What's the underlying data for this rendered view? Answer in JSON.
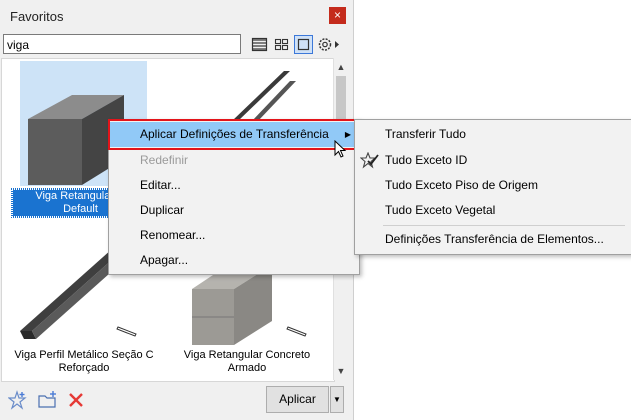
{
  "window": {
    "title": "Favoritos",
    "close": "×"
  },
  "search": {
    "value": "viga"
  },
  "items": [
    {
      "label": "Viga Retangular G... Default",
      "line1": "Viga Retangular G",
      "line2": "Default",
      "selected": true
    },
    {
      "label": "Viga Perfil Metálico Seção C Reforçado",
      "line1": "Viga Perfil Metálico Seção C",
      "line2": "Reforçado"
    },
    {
      "label": "Viga Retangular Concreto Armado",
      "line1": "Viga Retangular Concreto",
      "line2": "Armado"
    }
  ],
  "context_menu": {
    "items": [
      {
        "label": "Aplicar Definições de Transferência",
        "highlighted": true,
        "submenu": true
      },
      {
        "label": "Redefinir",
        "disabled": true
      },
      {
        "label": "Editar..."
      },
      {
        "label": "Duplicar"
      },
      {
        "label": "Renomear..."
      },
      {
        "label": "Apagar..."
      }
    ]
  },
  "submenu": {
    "items": [
      {
        "label": "Transferir Tudo"
      },
      {
        "label": "Tudo Exceto ID",
        "checked": true
      },
      {
        "label": "Tudo Exceto Piso de Origem"
      },
      {
        "label": "Tudo Exceto Vegetal"
      },
      {
        "label": "Definições Transferência de Elementos..."
      }
    ]
  },
  "bottom": {
    "apply_label": "Aplicar"
  },
  "colors": {
    "highlight": "#91c9f7",
    "selection": "#1a73d0",
    "callout": "#e3141a",
    "delete": "#e53935"
  }
}
